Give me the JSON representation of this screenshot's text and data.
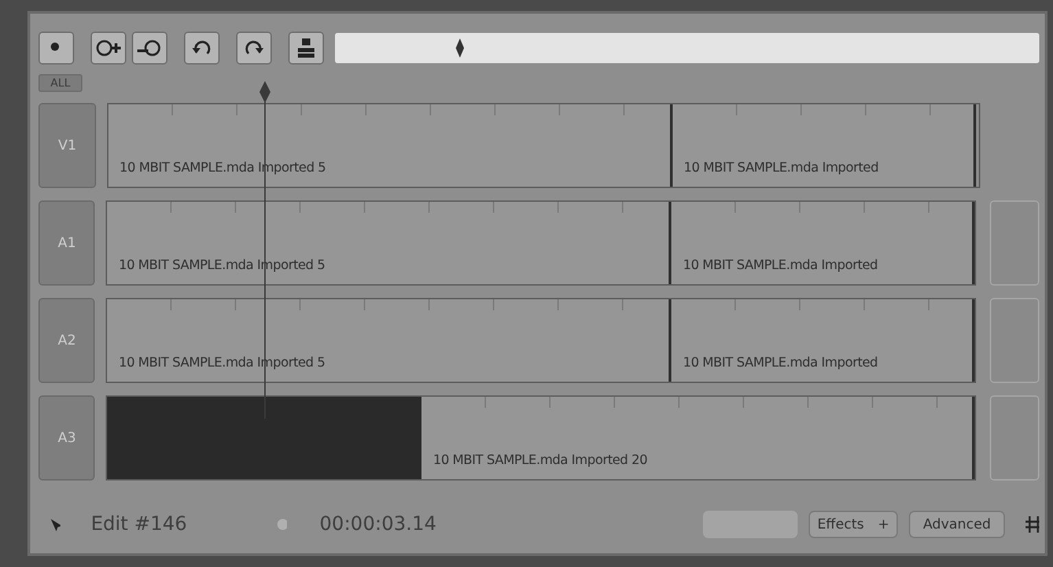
{
  "toolbar": {
    "all_button": "ALL"
  },
  "tracks": [
    {
      "label": "V1",
      "kind": "video",
      "clips": [
        {
          "kind": "clip",
          "label": "10 MBIT SAMPLE.mda Imported 5"
        },
        {
          "kind": "clip",
          "label": "10 MBIT SAMPLE.mda Imported"
        }
      ]
    },
    {
      "label": "A1",
      "kind": "audio",
      "clips": [
        {
          "kind": "clip",
          "label": "10 MBIT SAMPLE.mda Imported 5"
        },
        {
          "kind": "clip",
          "label": "10 MBIT SAMPLE.mda Imported"
        }
      ]
    },
    {
      "label": "A2",
      "kind": "audio",
      "clips": [
        {
          "kind": "clip",
          "label": "10 MBIT SAMPLE.mda Imported 5"
        },
        {
          "kind": "clip",
          "label": "10 MBIT SAMPLE.mda Imported"
        }
      ]
    },
    {
      "label": "A3",
      "kind": "audio",
      "clips": [
        {
          "kind": "gap"
        },
        {
          "kind": "clip",
          "label": "10 MBIT SAMPLE.mda Imported 20"
        }
      ]
    }
  ],
  "status_bar": {
    "edit": "Edit #146",
    "timecode": "00:00:03.14",
    "effects": "Effects",
    "effects_more": "+",
    "advanced": "Advanced"
  }
}
